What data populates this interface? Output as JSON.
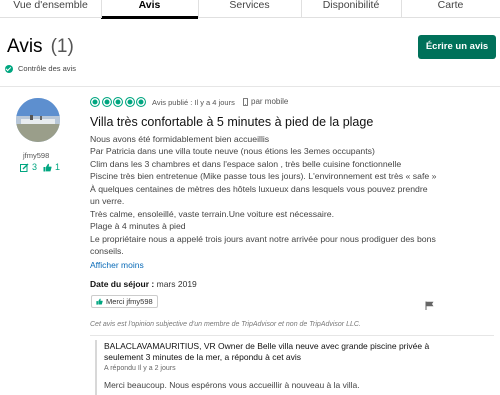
{
  "tabs": [
    "Vue d'ensemble",
    "Avis",
    "Services",
    "Disponibilité",
    "Carte"
  ],
  "header": {
    "title": "Avis",
    "count": "(1)",
    "write_review": "Écrire un avis"
  },
  "control_note": "Contrôle des avis",
  "review": {
    "user": {
      "name": "jfmy598",
      "contributions": "3",
      "helpful_votes": "1"
    },
    "rating": 5,
    "published": "Avis publié : Il y a 4 jours",
    "device": "par mobile",
    "title": "Villa très confortable à 5 minutes à pied de la plage",
    "lines": [
      "Nous avons été formidablement bien accueillis",
      "Par Patricia dans une villa toute neuve (nous étions les 3emes occupants)",
      "Clim dans les 3 chambres et dans l'espace salon , très belle cuisine fonctionnelle",
      "Piscine très bien entretenue (Mike passe tous les jours). L'environnement est très « safe »",
      "À quelques centaines de mètres des hôtels luxueux dans lesquels vous pouvez prendre",
      "un verre.",
      "Très calme, ensoleillé, vaste terrain.Une voiture est nécessaire.",
      "Plage à 4 minutes à pied",
      "Le propriétaire nous a appelé trois jours avant notre arrivée pour nous prodiguer des bons",
      "conseils."
    ],
    "more": "Afficher moins",
    "stay_label": "Date du séjour :",
    "stay_value": "mars 2019",
    "thanks": "Merci jfmy598",
    "disclaimer": "Cet avis est l'opinion subjective d'un membre de TripAdvisor et non de TripAdvisor LLC."
  },
  "response": {
    "title_lines": [
      "BALACLAVAMAURITIUS, VR Owner de Belle villa neuve avec grande piscine privée à",
      "seulement 3 minutes de la mer, a répondu à cet avis"
    ],
    "date": "A répondu Il y a 2 jours",
    "text": "Merci beaucoup. Nous espérons vous accueillir à nouveau à la villa."
  },
  "colors": {
    "brand_green": "#00715a",
    "bubble_green": "#00a680",
    "link_blue": "#0a6bb8"
  }
}
